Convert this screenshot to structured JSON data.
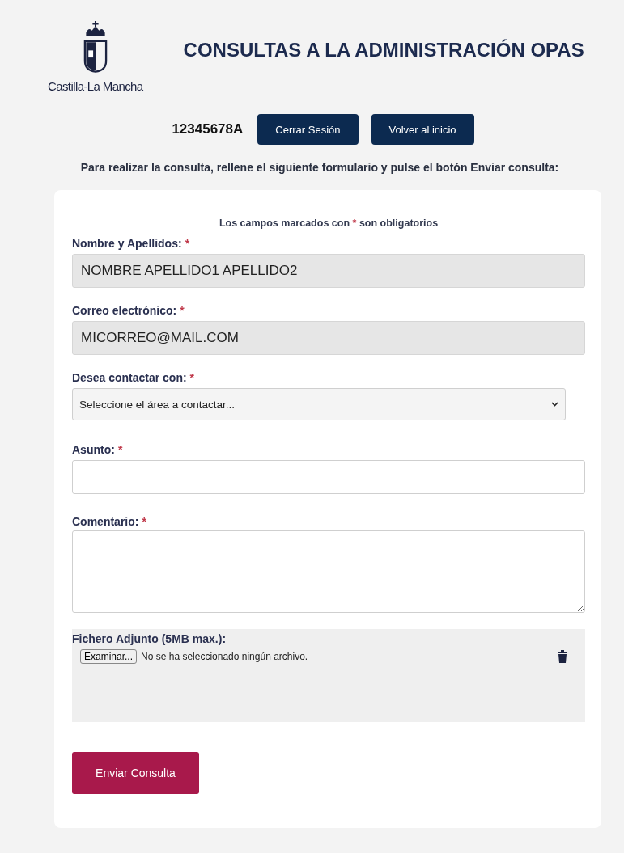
{
  "header": {
    "logo_text": "Castilla-La Mancha",
    "title": "CONSULTAS A LA ADMINISTRACIÓN OPAS"
  },
  "session": {
    "user_id": "12345678A",
    "buttons": [
      "Cerrar Sesión",
      "Volver al inicio"
    ]
  },
  "instructions": "Para realizar la consulta, rellene el siguiente formulario y pulse el botón Enviar consulta:",
  "form": {
    "note": {
      "before": "Los campos marcados con",
      "mark": "*",
      "after": "son obligatorios"
    },
    "fields": [
      {
        "kind": "readonly",
        "label": "Nombre y Apellidos:",
        "required": true,
        "value": "NOMBRE APELLIDO1 APELLIDO2"
      },
      {
        "kind": "readonly",
        "label": "Correo electrónico:",
        "required": true,
        "value": "MICORREO@MAIL.COM"
      },
      {
        "kind": "select",
        "label": "Desea contactar con:",
        "required": true,
        "value": "Seleccione el área a contactar..."
      },
      {
        "kind": "input",
        "label": "Asunto:",
        "required": true
      },
      {
        "kind": "textarea",
        "label": "Comentario:",
        "required": true
      }
    ],
    "attachment": {
      "label": "Fichero Adjunto (5MB max.):",
      "browse_button": "Examinar...",
      "status": "No se ha seleccionado ningún archivo."
    },
    "submit": "Enviar Consulta"
  }
}
